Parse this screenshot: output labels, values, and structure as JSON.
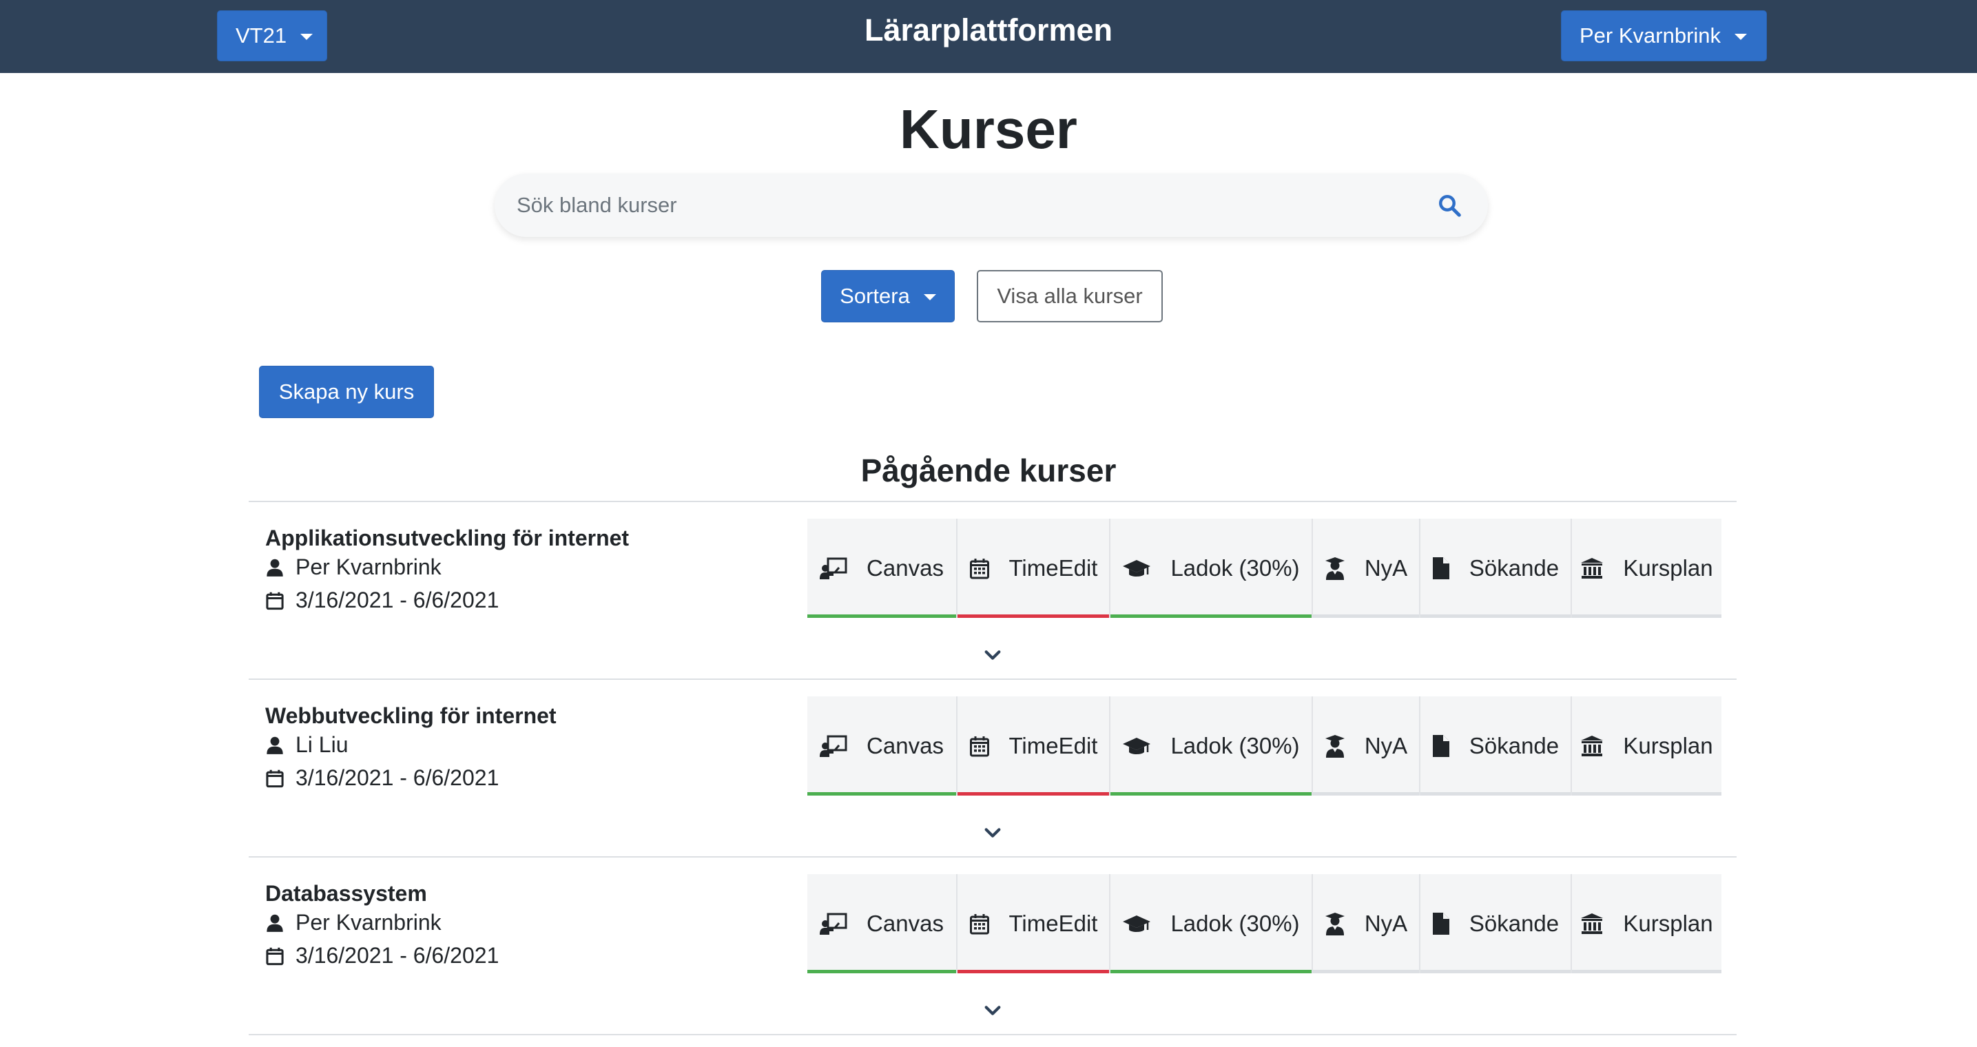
{
  "navbar": {
    "semester_label": "VT21",
    "title": "Lärarplattformen",
    "user_label": "Per Kvarnbrink"
  },
  "page": {
    "title": "Kurser",
    "search_placeholder": "Sök bland kurser",
    "sort_label": "Sortera",
    "show_all_label": "Visa alla kurser",
    "create_label": "Skapa ny kurs",
    "section_title": "Pågående kurser"
  },
  "colors": {
    "navbar": "#2f4259",
    "primary": "#2f6fc8",
    "status_ok": "#4caf50",
    "status_error": "#dc3545",
    "status_none": "#dcdfe3"
  },
  "courses": [
    {
      "name": "Applikationsutveckling för internet",
      "teacher": "Per Kvarnbrink",
      "dates": "3/16/2021 - 6/6/2021",
      "tabs": [
        {
          "label": "Canvas",
          "icon": "chalkboard-teacher-icon",
          "status": "ok"
        },
        {
          "label": "TimeEdit",
          "icon": "calendar-icon",
          "status": "error"
        },
        {
          "label": "Ladok (30%)",
          "icon": "graduation-cap-icon",
          "status": "ok"
        },
        {
          "label": "NyA",
          "icon": "user-graduate-icon",
          "status": "none"
        },
        {
          "label": "Sökande",
          "icon": "file-icon",
          "status": "none"
        },
        {
          "label": "Kursplan",
          "icon": "university-icon",
          "status": "none"
        }
      ]
    },
    {
      "name": "Webbutveckling för internet",
      "teacher": "Li Liu",
      "dates": "3/16/2021 - 6/6/2021",
      "tabs": [
        {
          "label": "Canvas",
          "icon": "chalkboard-teacher-icon",
          "status": "ok"
        },
        {
          "label": "TimeEdit",
          "icon": "calendar-icon",
          "status": "error"
        },
        {
          "label": "Ladok (30%)",
          "icon": "graduation-cap-icon",
          "status": "ok"
        },
        {
          "label": "NyA",
          "icon": "user-graduate-icon",
          "status": "none"
        },
        {
          "label": "Sökande",
          "icon": "file-icon",
          "status": "none"
        },
        {
          "label": "Kursplan",
          "icon": "university-icon",
          "status": "none"
        }
      ]
    },
    {
      "name": "Databassystem",
      "teacher": "Per Kvarnbrink",
      "dates": "3/16/2021 - 6/6/2021",
      "tabs": [
        {
          "label": "Canvas",
          "icon": "chalkboard-teacher-icon",
          "status": "ok"
        },
        {
          "label": "TimeEdit",
          "icon": "calendar-icon",
          "status": "error"
        },
        {
          "label": "Ladok (30%)",
          "icon": "graduation-cap-icon",
          "status": "ok"
        },
        {
          "label": "NyA",
          "icon": "user-graduate-icon",
          "status": "none"
        },
        {
          "label": "Sökande",
          "icon": "file-icon",
          "status": "none"
        },
        {
          "label": "Kursplan",
          "icon": "university-icon",
          "status": "none"
        }
      ]
    }
  ]
}
